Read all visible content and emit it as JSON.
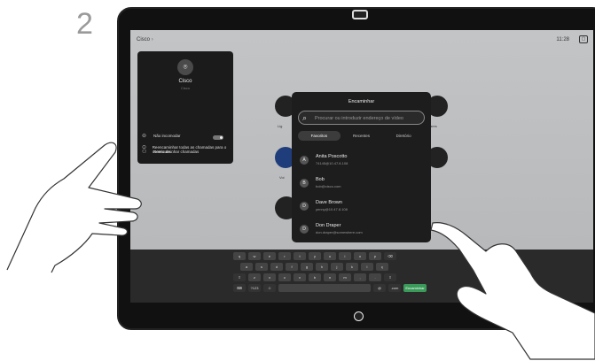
{
  "step_number": "2",
  "screen": {
    "brand": "Cisco",
    "brand_chevron": "›",
    "time": "11:28",
    "top_icon": "screen-share-icon"
  },
  "background_apps": [
    {
      "label": "Lig",
      "icon": "video-icon"
    },
    {
      "label": "Voi",
      "icon": "phone-icon"
    },
    {
      "label": "ares",
      "icon": "share-icon"
    }
  ],
  "profile_menu": {
    "name": "Cisco",
    "subtitle": "Cisco",
    "items": [
      {
        "label": "Não incomodar",
        "icon": "do-not-disturb-icon"
      },
      {
        "label": "Reencaminhar chamadas",
        "icon": "forward-calls-icon"
      },
      {
        "label": "Reencaminhar todas as chamadas para o correio de...",
        "icon": "voicemail-icon"
      }
    ],
    "dnd_toggle": "off"
  },
  "forward_dialog": {
    "title": "Encaminhar",
    "search_placeholder": "Procurar ou introduzir endereço de vídeo",
    "tabs": [
      "Favoritos",
      "Recentes",
      "Diretório"
    ],
    "active_tab": "Favoritos",
    "contacts": [
      {
        "initial": "A",
        "name": "Anita Poscotto",
        "address": "74145@10.47.8.108"
      },
      {
        "initial": "B",
        "name": "Bob",
        "address": "bob@cisco.com"
      },
      {
        "initial": "D",
        "name": "Dave Brown",
        "address": "yenny@10.47.8.108"
      },
      {
        "initial": "D",
        "name": "Don Draper",
        "address": "don.draper@somewhere.com"
      }
    ]
  },
  "keyboard": {
    "row1": [
      "q",
      "w",
      "e",
      "r",
      "t",
      "y",
      "u",
      "i",
      "o",
      "p",
      "⌫"
    ],
    "row2": [
      "a",
      "s",
      "d",
      "f",
      "g",
      "h",
      "j",
      "k",
      "l",
      "ç"
    ],
    "row3": [
      "⇧",
      "z",
      "x",
      "c",
      "v",
      "b",
      "n",
      "m",
      ",",
      ".",
      "⇧"
    ],
    "row4": [
      "⌨",
      "?123",
      "☺",
      "",
      "@",
      ".com",
      "Encaminhar"
    ],
    "action_key": "Encaminhar"
  },
  "colors": {
    "accent_green": "#3a9a5a",
    "dialog_bg": "#1d1d1d",
    "screen_bg": "#b8babc"
  }
}
